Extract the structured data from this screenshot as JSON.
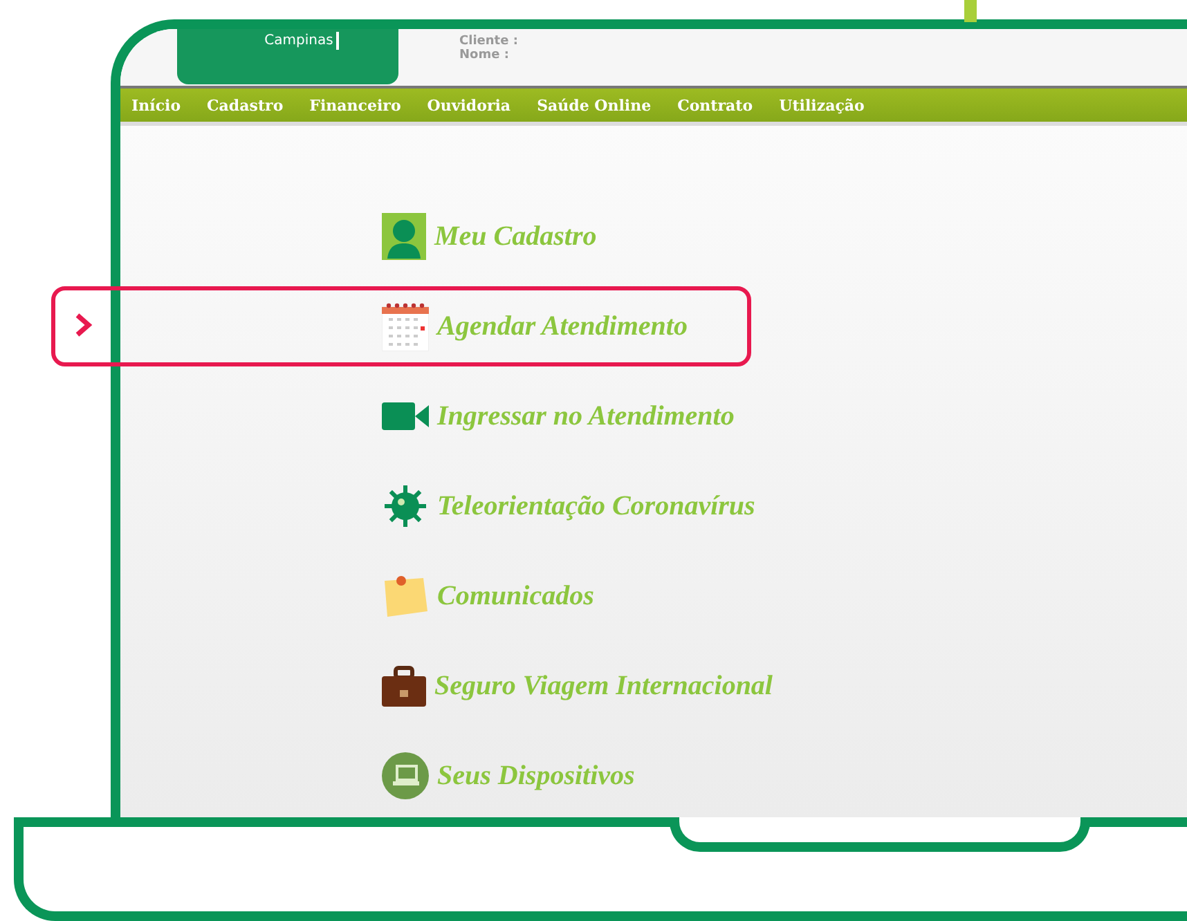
{
  "header": {
    "location": "Campinas",
    "fields": [
      "Cliente :",
      "Nome :"
    ]
  },
  "nav": [
    "Início",
    "Cadastro",
    "Financeiro",
    "Ouvidoria",
    "Saúde Online",
    "Contrato",
    "Utilização"
  ],
  "menu": [
    {
      "label": "Meu Cadastro",
      "kind": "person",
      "selected": false
    },
    {
      "label": "Agendar Atendimento",
      "kind": "calendar",
      "selected": true
    },
    {
      "label": "Ingressar no Atendimento",
      "kind": "video",
      "selected": false
    },
    {
      "label": "Teleorientação Coronavírus",
      "kind": "virus",
      "selected": false
    },
    {
      "label": "Comunicados",
      "kind": "note",
      "selected": false
    },
    {
      "label": "Seguro Viagem Internacional",
      "kind": "briefcase",
      "selected": false
    },
    {
      "label": "Seus Dispositivos",
      "kind": "device",
      "selected": false
    }
  ]
}
